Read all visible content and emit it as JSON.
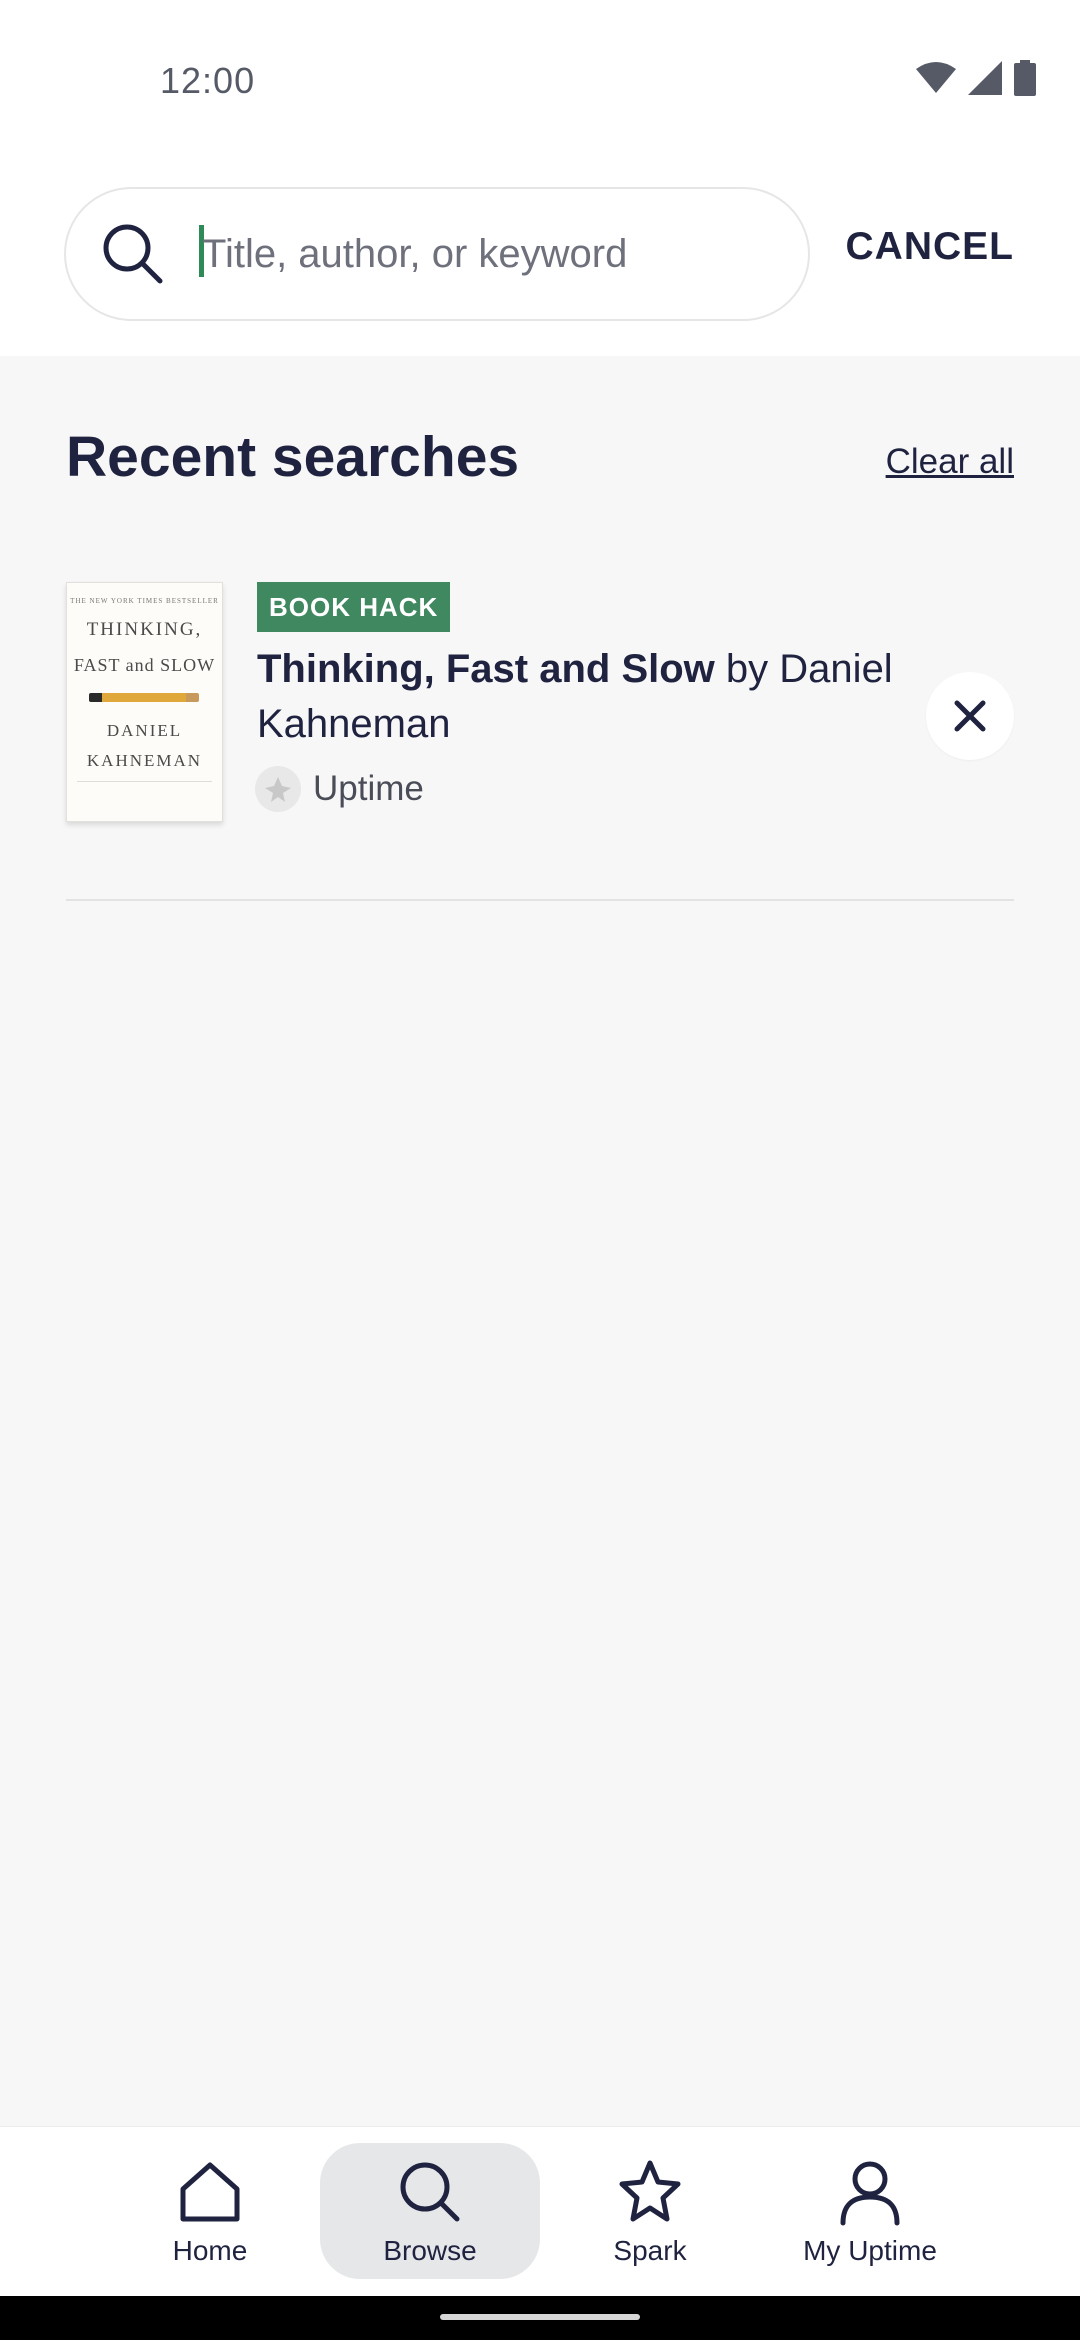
{
  "status_bar": {
    "time": "12:00",
    "icons": [
      "wifi-icon",
      "signal-icon",
      "battery-icon"
    ]
  },
  "search": {
    "placeholder": "Title, author, or keyword",
    "value": "",
    "cancel_label": "CANCEL"
  },
  "recent": {
    "heading": "Recent searches",
    "clear_all_label": "Clear all",
    "items": [
      {
        "badge": "BOOK HACK",
        "title": "Thinking, Fast and Slow",
        "by": "by",
        "author": "Daniel Kahneman",
        "source": "Uptime",
        "cover": {
          "top_line": "THE NEW YORK TIMES BESTSELLER",
          "title_line_1": "THINKING,",
          "title_line_2": "FAST and SLOW",
          "author_line_1": "DANIEL",
          "author_line_2": "KAHNEMAN"
        }
      }
    ]
  },
  "bottom_nav": {
    "items": [
      {
        "label": "Home",
        "icon": "home-icon",
        "active": false
      },
      {
        "label": "Browse",
        "icon": "search-icon",
        "active": true
      },
      {
        "label": "Spark",
        "icon": "star-icon",
        "active": false
      },
      {
        "label": "My Uptime",
        "icon": "person-icon",
        "active": false
      }
    ]
  },
  "colors": {
    "primary_text": "#1f2340",
    "badge_green": "#3f8860",
    "caret_green": "#2e8a57",
    "background": "#f7f7f7",
    "active_nav_bg": "#e6e7e9"
  }
}
